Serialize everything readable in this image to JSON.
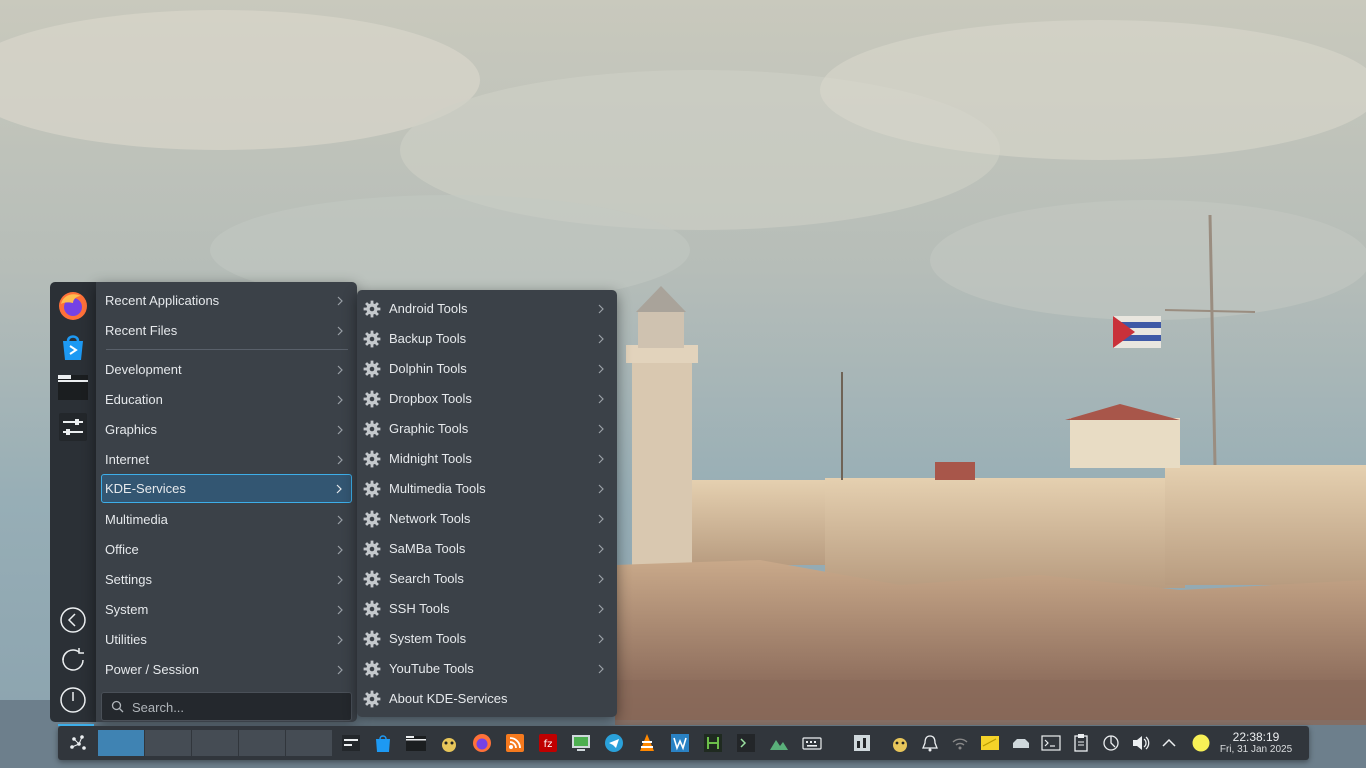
{
  "favorites": [
    {
      "name": "firefox-icon"
    },
    {
      "name": "discover-store-icon"
    },
    {
      "name": "file-manager-icon"
    },
    {
      "name": "system-settings-icon"
    }
  ],
  "session_buttons": [
    {
      "name": "back-icon"
    },
    {
      "name": "restart-icon"
    },
    {
      "name": "power-icon"
    }
  ],
  "menu": {
    "items": [
      {
        "label": "Recent Applications"
      },
      {
        "label": "Recent Files"
      },
      {
        "label": "Development"
      },
      {
        "label": "Education"
      },
      {
        "label": "Graphics"
      },
      {
        "label": "Internet"
      },
      {
        "label": "KDE-Services"
      },
      {
        "label": "Multimedia"
      },
      {
        "label": "Office"
      },
      {
        "label": "Settings"
      },
      {
        "label": "System"
      },
      {
        "label": "Utilities"
      },
      {
        "label": "Power / Session"
      }
    ],
    "active_item": "KDE-Services",
    "search_placeholder": "Search..."
  },
  "submenu": {
    "items": [
      {
        "label": "Android Tools",
        "has_submenu": true
      },
      {
        "label": "Backup Tools",
        "has_submenu": true
      },
      {
        "label": "Dolphin Tools",
        "has_submenu": true
      },
      {
        "label": "Dropbox Tools",
        "has_submenu": true
      },
      {
        "label": "Graphic Tools",
        "has_submenu": true
      },
      {
        "label": "Midnight Tools",
        "has_submenu": true
      },
      {
        "label": "Multimedia Tools",
        "has_submenu": true
      },
      {
        "label": "Network Tools",
        "has_submenu": true
      },
      {
        "label": "SaMBa Tools",
        "has_submenu": true
      },
      {
        "label": "Search Tools",
        "has_submenu": true
      },
      {
        "label": "SSH Tools",
        "has_submenu": true
      },
      {
        "label": "System Tools",
        "has_submenu": true
      },
      {
        "label": "YouTube Tools",
        "has_submenu": true
      },
      {
        "label": "About KDE-Services",
        "has_submenu": false
      }
    ]
  },
  "taskbar": {
    "virtual_desktops": 5,
    "current_desktop": 1,
    "apps": [
      "system-monitor-icon",
      "discover-icon",
      "file-manager-icon",
      "ktuberling-icon",
      "firefox-icon",
      "rss-reader-icon",
      "filezilla-icon",
      "remote-desktop-icon",
      "telegram-icon",
      "vlc-icon",
      "kwrite-icon",
      "htop-icon",
      "terminal-icon",
      "image-viewer-icon",
      "virtual-keyboard-icon"
    ],
    "tray": [
      "task-manager-icon",
      "ktuberling-tray-icon",
      "notifications-icon",
      "network-icon",
      "sticky-notes-icon",
      "storage-icon",
      "terminal-tray-icon",
      "clipboard-icon",
      "kde-connect-icon",
      "volume-icon",
      "expand-tray-icon",
      "night-light-icon"
    ],
    "clock_time": "22:38:19",
    "clock_date": "Fri, 31 Jan 2025"
  },
  "colors": {
    "accent": "#3daee9",
    "menu_bg": "#3b4148",
    "panel_bg": "#31363c",
    "highlight_bg": "#335672"
  }
}
